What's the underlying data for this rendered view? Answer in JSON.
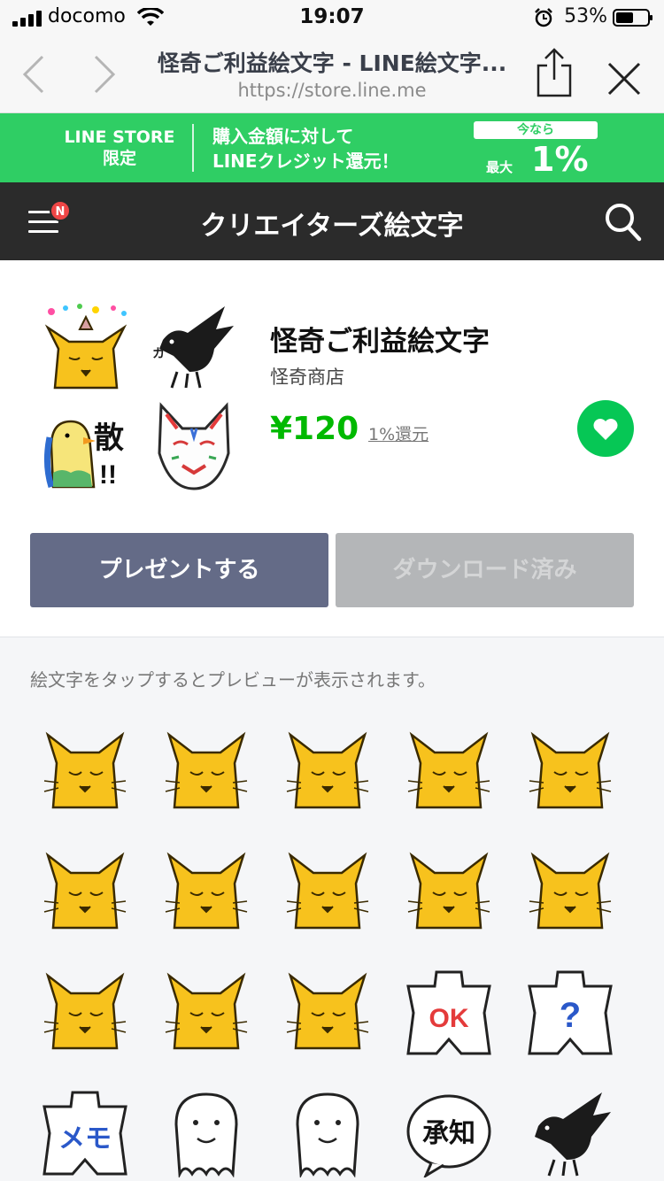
{
  "status_bar": {
    "carrier": "docomo",
    "time": "19:07",
    "battery": "53%"
  },
  "browser": {
    "title": "怪奇ご利益絵文字 - LINE絵文字...",
    "url": "https://store.line.me"
  },
  "promo": {
    "store_line1": "LINE STORE",
    "store_line2": "限定",
    "msg_line1": "購入金額に対して",
    "msg_line2": "LINEクレジット還元！",
    "badge": "今なら",
    "max": "最大",
    "pct": "1%"
  },
  "header": {
    "title": "クリエイターズ絵文字",
    "notif": "N"
  },
  "product": {
    "name": "怪奇ご利益絵文字",
    "author": "怪奇商店",
    "price": "¥120",
    "reward": "1%還元",
    "gift_label": "プレゼントする",
    "download_label": "ダウンロード済み"
  },
  "preview": {
    "hint": "絵文字をタップするとプレビューが表示されます。",
    "items": [
      {
        "kind": "fox",
        "text": ""
      },
      {
        "kind": "fox",
        "text": ""
      },
      {
        "kind": "fox",
        "text": ""
      },
      {
        "kind": "fox",
        "text": ""
      },
      {
        "kind": "fox",
        "text": ""
      },
      {
        "kind": "fox",
        "text": ""
      },
      {
        "kind": "fox",
        "text": ""
      },
      {
        "kind": "fox",
        "text": ""
      },
      {
        "kind": "fox",
        "text": ""
      },
      {
        "kind": "fox",
        "text": ""
      },
      {
        "kind": "fox",
        "text": ""
      },
      {
        "kind": "fox",
        "text": ""
      },
      {
        "kind": "fox",
        "text": ""
      },
      {
        "kind": "sign",
        "text": "OK"
      },
      {
        "kind": "sign",
        "text": "?"
      },
      {
        "kind": "sign",
        "text": "メモ"
      },
      {
        "kind": "ghost",
        "text": ""
      },
      {
        "kind": "ghost",
        "text": ""
      },
      {
        "kind": "bubble",
        "text": "承知"
      },
      {
        "kind": "crow",
        "text": ""
      }
    ]
  },
  "colors": {
    "line_green": "#06c755",
    "price_green": "#00b900",
    "header_dark": "#2b2b2b",
    "gift_button": "#646b87"
  }
}
